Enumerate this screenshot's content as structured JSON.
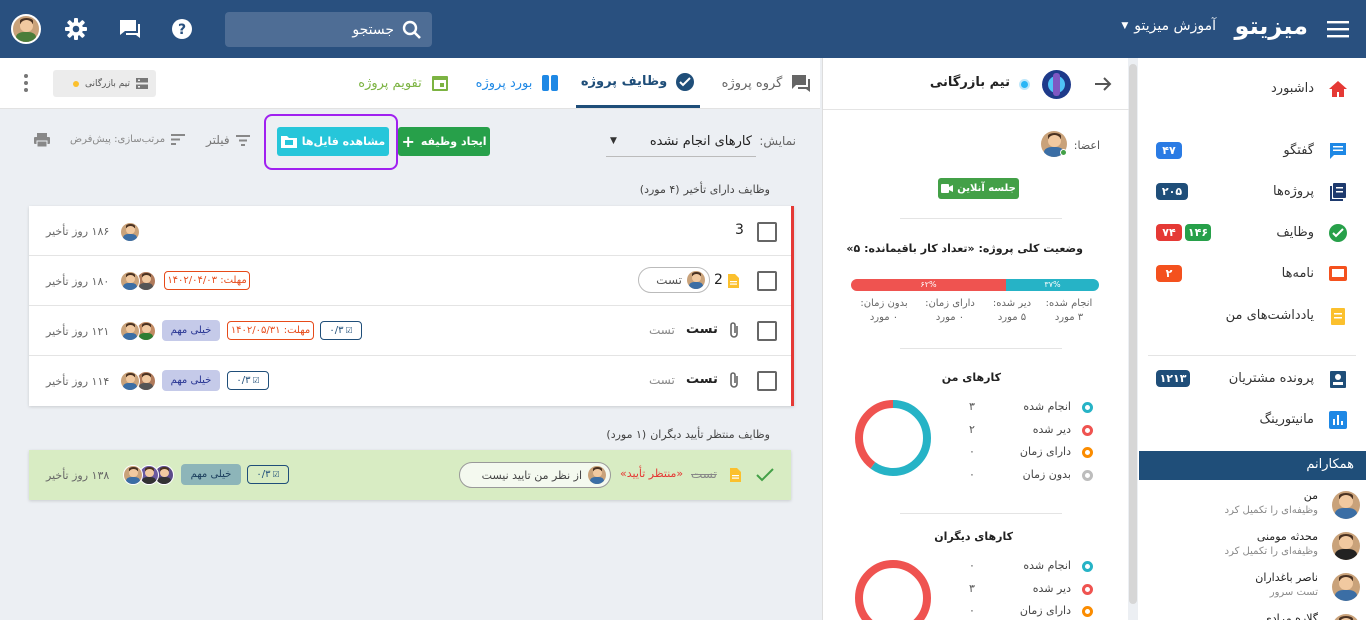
{
  "topbar": {
    "logo": "میزیتو",
    "workspace": "آموزش میزیتو",
    "search_placeholder": "جستجو"
  },
  "sidebar": {
    "items": [
      {
        "label": "داشبورد",
        "icon": "home-icon",
        "color": "#e53935"
      },
      {
        "label": "گفتگو",
        "icon": "chat-icon",
        "color": "#1e88e5",
        "badges": [
          {
            "text": "۴۷",
            "color": "#2a7be4"
          }
        ]
      },
      {
        "label": "پروژه‌ها",
        "icon": "projects-icon",
        "color": "#1e3a6e",
        "badges": [
          {
            "text": "۲۰۵",
            "color": "#1f4e79"
          }
        ]
      },
      {
        "label": "وظایف",
        "icon": "tasks-check-icon",
        "color": "#27a04a",
        "badges": [
          {
            "text": "۱۴۶",
            "color": "#27a04a"
          },
          {
            "text": "۷۴",
            "color": "#e53935"
          }
        ]
      },
      {
        "label": "نامه‌ها",
        "icon": "mail-icon",
        "color": "#f4511e",
        "badges": [
          {
            "text": "۲",
            "color": "#f4511e"
          }
        ]
      },
      {
        "label": "یادداشت‌های من",
        "icon": "notes-icon",
        "color": "#fbc02d"
      },
      {
        "label": "پرونده مشتریان",
        "icon": "customers-icon",
        "color": "#1f4e79",
        "badges": [
          {
            "text": "۱۲۱۳",
            "color": "#1f4e79"
          }
        ]
      },
      {
        "label": "مانیتورینگ",
        "icon": "monitoring-icon",
        "color": "#1e88e5"
      }
    ],
    "colleagues_header": "همکارانم",
    "colleagues": [
      {
        "name": "من",
        "status": "وظیفه‌ای را تکمیل کرد"
      },
      {
        "name": "محدثه مومنی",
        "status": "وظیفه‌ای را تکمیل کرد"
      },
      {
        "name": "ناصر باغداران",
        "status": "تست سرور"
      },
      {
        "name": "گلاره مرادی",
        "status": ""
      }
    ]
  },
  "team_panel": {
    "team_name": "تیم بازرگانی",
    "members_label": "اعضا:",
    "online_meeting": "جلسه آنلاین",
    "status_title": "وضعیت کلی پروژه: «تعداد کار باقیمانده: ۵»",
    "progress": {
      "done_pct_label": "۳۷%",
      "late_pct_label": "۶۲%",
      "done_fraction": 0.375,
      "late_fraction": 0.625
    },
    "stats": [
      {
        "label": "انجام شده:",
        "value": "۳ مورد"
      },
      {
        "label": "دیر شده:",
        "value": "۵ مورد"
      },
      {
        "label": "دارای زمان:",
        "value": "۰ مورد"
      },
      {
        "label": "بدون زمان:",
        "value": "۰ مورد"
      }
    ],
    "my_tasks_title": "کارهای من",
    "my_tasks": [
      {
        "label": "انجام شده",
        "value": "۳",
        "color": "#26b3c6"
      },
      {
        "label": "دیر شده",
        "value": "۲",
        "color": "#ef5350"
      },
      {
        "label": "دارای زمان",
        "value": "۰",
        "color": "#fb8c00"
      },
      {
        "label": "بدون زمان",
        "value": "۰",
        "color": "#bdbdbd"
      }
    ],
    "others_title": "کارهای دیگران",
    "others_tasks": [
      {
        "label": "انجام شده",
        "value": "۰",
        "color": "#26b3c6"
      },
      {
        "label": "دیر شده",
        "value": "۳",
        "color": "#ef5350"
      },
      {
        "label": "دارای زمان",
        "value": "۰",
        "color": "#fb8c00"
      }
    ]
  },
  "tabs": [
    {
      "label": "گروه پروژه",
      "icon": "group-chat-icon",
      "color": "#666"
    },
    {
      "label": "وظایف پروژه",
      "icon": "tasks-icon",
      "color": "#1f4e79",
      "active": true
    },
    {
      "label": "بورد پروژه",
      "icon": "board-icon",
      "color": "#1e88e5"
    },
    {
      "label": "تقویم پروژه",
      "icon": "calendar-icon",
      "color": "#7cb342"
    }
  ],
  "team_chip": "تیم بازرگانی",
  "toolbar": {
    "display_label": "نمایش:",
    "display_value": "کارهای انجام نشده",
    "create_task": "ایجاد وظیفه",
    "view_files": "مشاهده فایل‌ها",
    "filter": "فیلتر",
    "sort": "مرتب‌سازی: پیش‌فرض"
  },
  "delayed_section": {
    "title": "وظایف دارای تأخیر",
    "count": "(۴ مورد)",
    "rows": [
      {
        "title": "3",
        "delay": "۱۸۶ روز تأخیر"
      },
      {
        "title": "2",
        "delay": "۱۸۰ روز تأخیر",
        "chip": "تست",
        "deadline": "مهلت: ۱۴۰۲/۰۴/۰۳"
      },
      {
        "title": "تست",
        "subtitle": "تست",
        "delay": "۱۲۱ روز تأخیر",
        "priority": "خیلی مهم",
        "deadline": "مهلت: ۱۴۰۲/۰۵/۳۱",
        "checklist": "۰/۳"
      },
      {
        "title": "تست",
        "subtitle": "تست",
        "delay": "۱۱۴ روز تأخیر",
        "priority": "خیلی مهم",
        "checklist": "۰/۳"
      }
    ]
  },
  "pending_section": {
    "title": "وظایف منتظر تأیید دیگران",
    "count": "(۱ مورد)",
    "row": {
      "title": "تست",
      "status": "«منتظر تأیید»",
      "disapprove": "از نظر من تایید نیست",
      "priority": "خیلی مهم",
      "checklist": "۰/۳",
      "delay": "۱۳۸ روز تأخیر"
    }
  }
}
